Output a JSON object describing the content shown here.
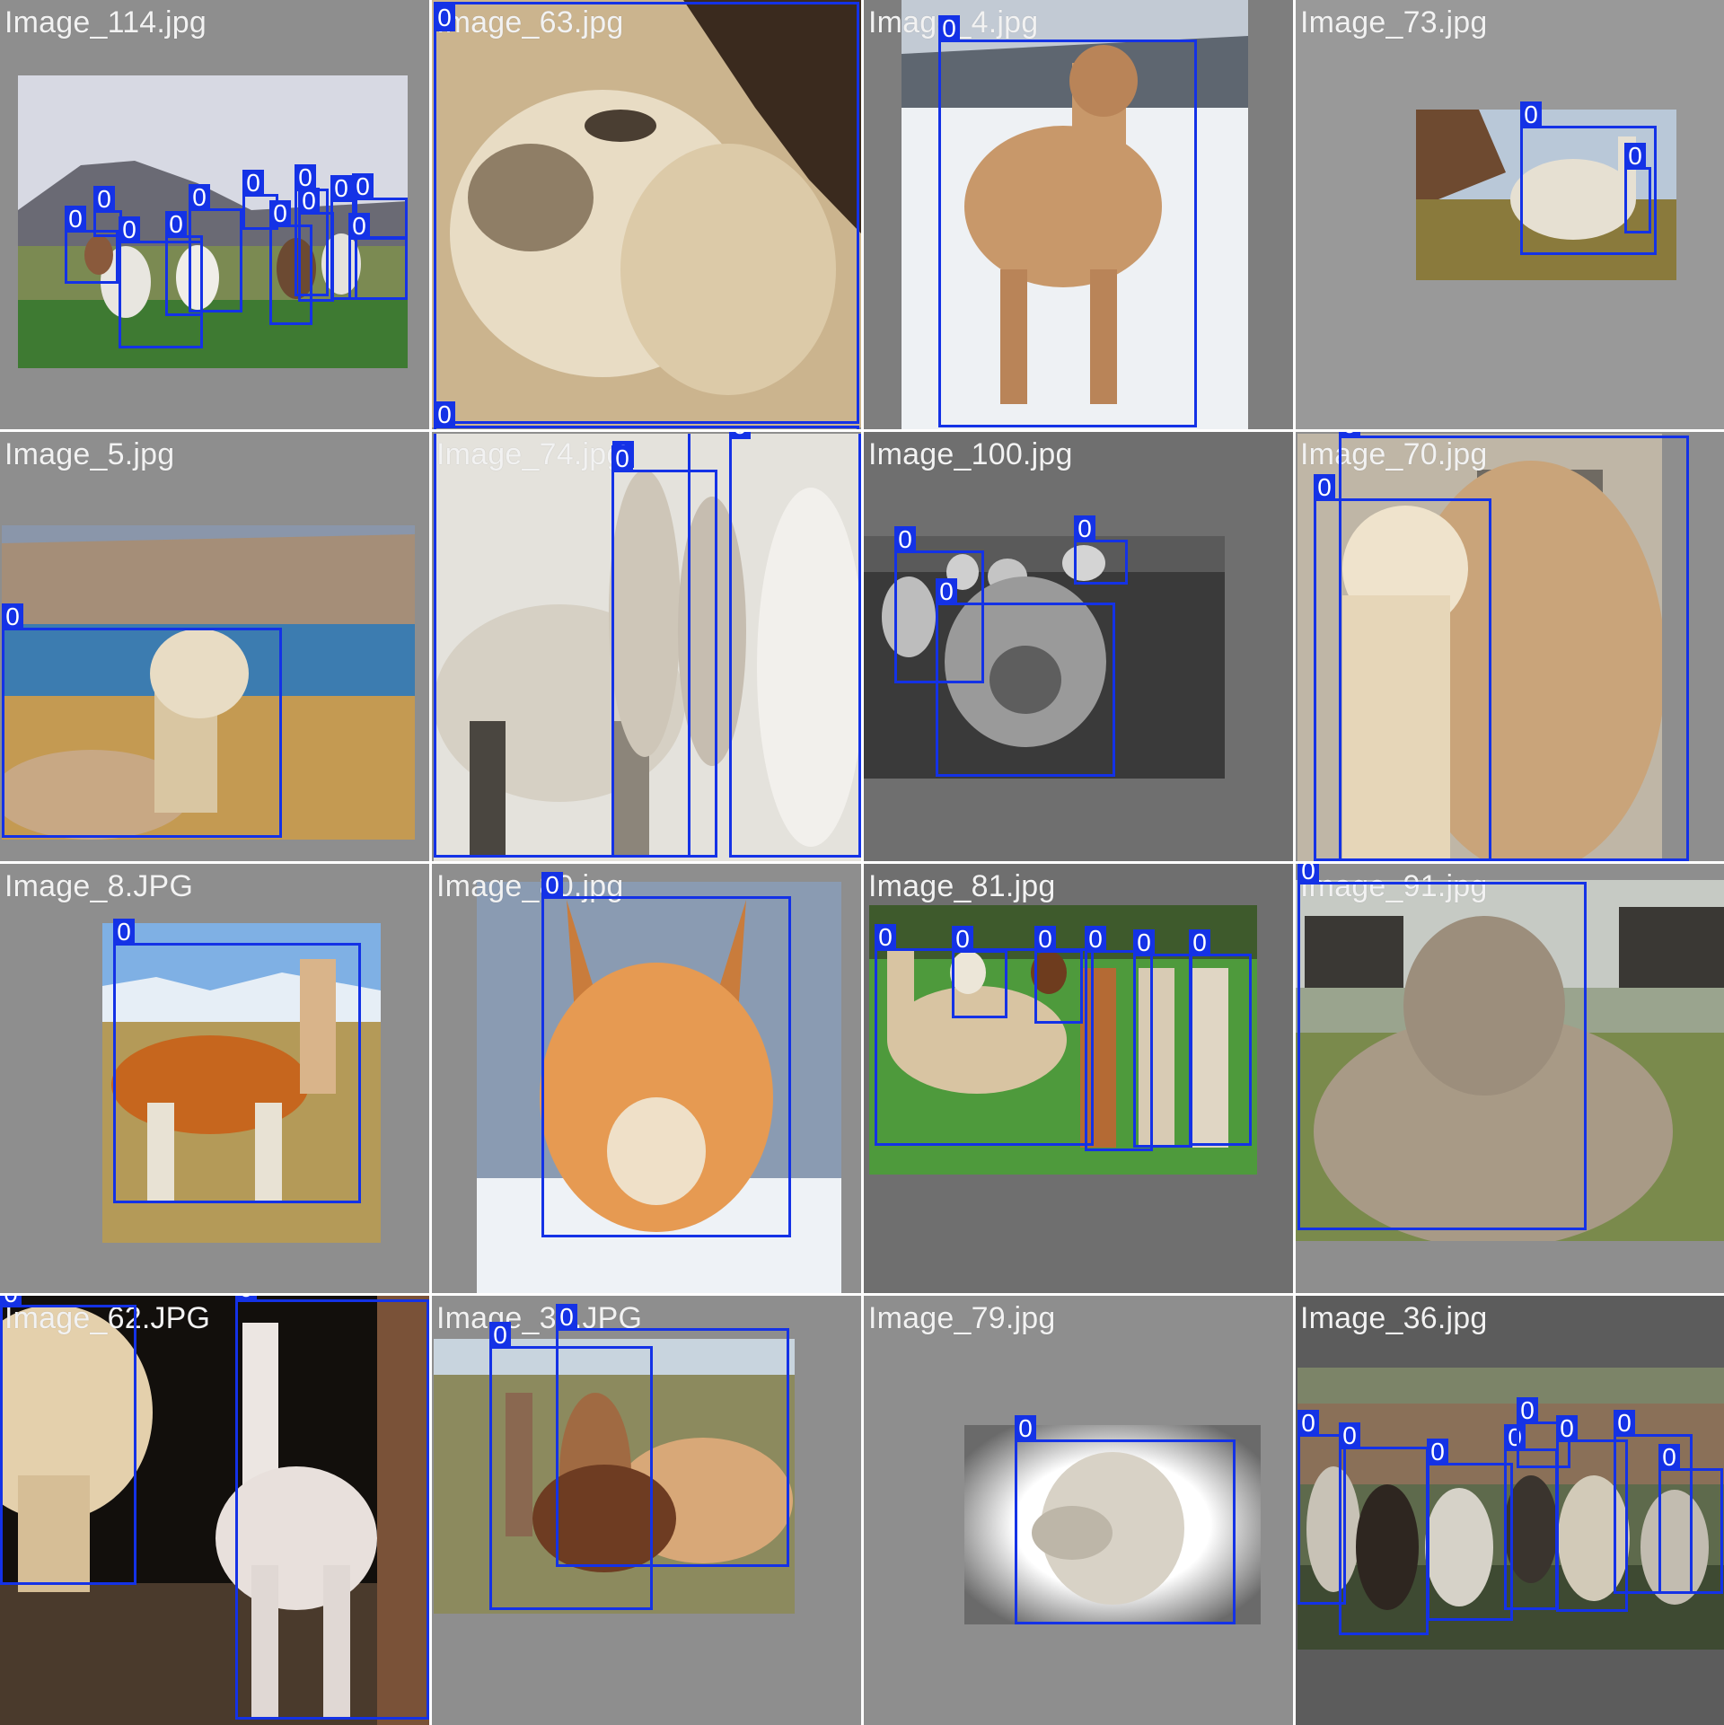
{
  "tiles": [
    {
      "filename": "Image_114.jpg",
      "labels": [
        "0",
        "0",
        "0",
        "0",
        "0",
        "0",
        "0",
        "0",
        "0",
        "0",
        "0",
        "0"
      ]
    },
    {
      "filename": "Image_63.jpg",
      "labels": [
        "0",
        "0"
      ]
    },
    {
      "filename": "Image_4.jpg",
      "labels": [
        "0"
      ]
    },
    {
      "filename": "Image_73.jpg",
      "labels": [
        "0",
        "0"
      ]
    },
    {
      "filename": "Image_5.jpg",
      "labels": [
        "0"
      ]
    },
    {
      "filename": "Image_74.jpg",
      "labels": [
        "0",
        "0",
        "0"
      ]
    },
    {
      "filename": "Image_100.jpg",
      "labels": [
        "0",
        "0",
        "0"
      ]
    },
    {
      "filename": "Image_70.jpg",
      "labels": [
        "0",
        "0"
      ]
    },
    {
      "filename": "Image_8.JPG",
      "labels": [
        "0"
      ]
    },
    {
      "filename": "Image_80.jpg",
      "labels": [
        "0"
      ]
    },
    {
      "filename": "Image_81.jpg",
      "labels": [
        "0",
        "0",
        "0",
        "0",
        "0",
        "0"
      ]
    },
    {
      "filename": "Image_91.jpg",
      "labels": [
        "0"
      ]
    },
    {
      "filename": "Image_62.JPG",
      "labels": [
        "0",
        "0"
      ]
    },
    {
      "filename": "Image_39.JPG",
      "labels": [
        "0",
        "0"
      ]
    },
    {
      "filename": "Image_79.jpg",
      "labels": [
        "0"
      ]
    },
    {
      "filename": "Image_36.jpg",
      "labels": [
        "0",
        "0",
        "0",
        "0",
        "0",
        "0",
        "0",
        "0"
      ]
    }
  ],
  "colors": {
    "box": "#1432e6",
    "label_text": "#ffffff",
    "filename_text": "#f2f2f2"
  }
}
